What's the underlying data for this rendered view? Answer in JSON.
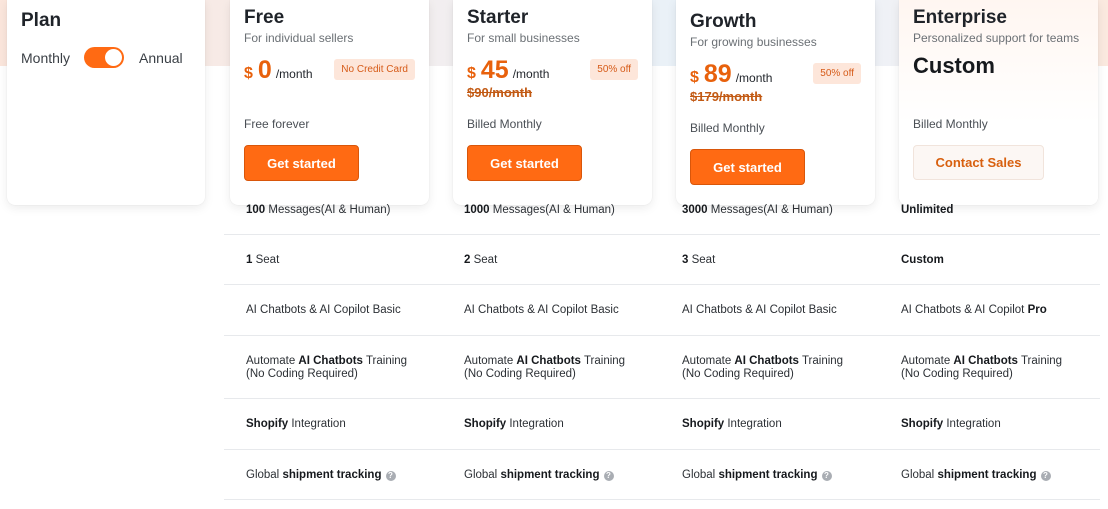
{
  "plan_panel": {
    "title": "Plan",
    "monthly_label": "Monthly",
    "annual_label": "Annual",
    "toggle_state": "annual"
  },
  "tiers": [
    {
      "name": "Free",
      "desc": "For individual sellers",
      "currency": "$",
      "price": "0",
      "per": "/month",
      "badge": "No Credit Card",
      "strike": "",
      "billing": "Free forever",
      "cta": "Get started"
    },
    {
      "name": "Starter",
      "desc": "For small businesses",
      "currency": "$",
      "price": "45",
      "per": "/month",
      "badge": "50% off",
      "strike": "$90/month",
      "billing": "Billed Monthly",
      "cta": "Get started"
    },
    {
      "name": "Growth",
      "desc": "For growing businesses",
      "currency": "$",
      "price": "89",
      "per": "/month",
      "badge": "50% off",
      "strike": "$179/month",
      "billing": "Billed Monthly",
      "cta": "Get started"
    },
    {
      "name": "Enterprise",
      "desc": "Personalized support for teams",
      "price_label": "Custom",
      "billing": "Billed Monthly",
      "cta": "Contact Sales"
    }
  ],
  "features": {
    "messages": {
      "free_num": "100",
      "starter_num": "1000",
      "growth_num": "3000",
      "suffix": " Messages(AI & Human)",
      "enterprise": "Unlimited"
    },
    "seats": {
      "free_num": "1",
      "starter_num": "2",
      "growth_num": "3",
      "suffix": " Seat",
      "enterprise": "Custom"
    },
    "chatbots": {
      "text": "AI Chatbots & AI Copilot Basic",
      "enterprise_prefix": "AI Chatbots & AI Copilot ",
      "enterprise_bold": "Pro"
    },
    "training": {
      "pre": "Automate ",
      "bold": "AI Chatbots",
      "post": " Training",
      "line2": "(No Coding Required)"
    },
    "shopify": {
      "bold": "Shopify",
      "post": " Integration"
    },
    "tracking": {
      "pre": "Global ",
      "bold": "shipment tracking",
      "help": "?"
    }
  },
  "colors": {
    "accent": "#ff6a13",
    "accent_text": "#e8610c",
    "badge_bg": "#fde6da"
  }
}
